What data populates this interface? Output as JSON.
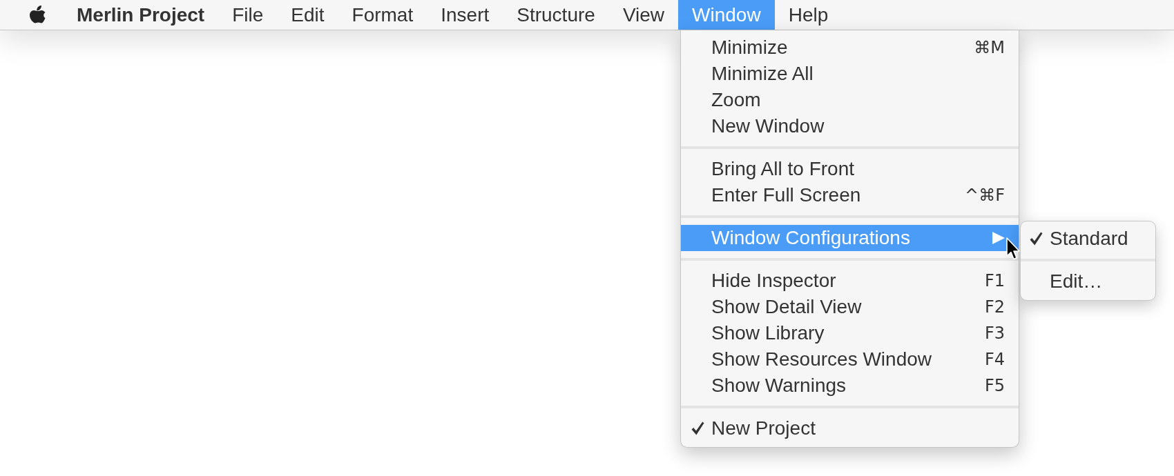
{
  "menu_bar": {
    "items": [
      {
        "label": "Merlin Project",
        "kind": "app",
        "selected": false
      },
      {
        "label": "File",
        "kind": "menu",
        "selected": false
      },
      {
        "label": "Edit",
        "kind": "menu",
        "selected": false
      },
      {
        "label": "Format",
        "kind": "menu",
        "selected": false
      },
      {
        "label": "Insert",
        "kind": "menu",
        "selected": false
      },
      {
        "label": "Structure",
        "kind": "menu",
        "selected": false
      },
      {
        "label": "View",
        "kind": "menu",
        "selected": false
      },
      {
        "label": "Window",
        "kind": "menu",
        "selected": true
      },
      {
        "label": "Help",
        "kind": "menu",
        "selected": false
      }
    ]
  },
  "menu": {
    "sections": [
      {
        "items": [
          {
            "label": "Minimize",
            "shortcut": "⌘M",
            "selected": false,
            "checked": false,
            "submenu": false
          },
          {
            "label": "Minimize All",
            "selected": false,
            "checked": false,
            "submenu": false
          },
          {
            "label": "Zoom",
            "selected": false,
            "checked": false,
            "submenu": false
          },
          {
            "label": "New Window",
            "selected": false,
            "checked": false,
            "submenu": false
          }
        ]
      },
      {
        "items": [
          {
            "label": "Bring All to Front",
            "selected": false,
            "checked": false,
            "submenu": false
          },
          {
            "label": "Enter Full Screen",
            "shortcut": "^⌘F",
            "selected": false,
            "checked": false,
            "submenu": false
          }
        ]
      },
      {
        "items": [
          {
            "label": "Window Configurations",
            "selected": true,
            "checked": false,
            "submenu": true
          }
        ]
      },
      {
        "items": [
          {
            "label": "Hide Inspector",
            "shortcut": "F1",
            "selected": false,
            "checked": false,
            "submenu": false
          },
          {
            "label": "Show Detail View",
            "shortcut": "F2",
            "selected": false,
            "checked": false,
            "submenu": false
          },
          {
            "label": "Show Library",
            "shortcut": "F3",
            "selected": false,
            "checked": false,
            "submenu": false
          },
          {
            "label": "Show Resources Window",
            "shortcut": "F4",
            "selected": false,
            "checked": false,
            "submenu": false
          },
          {
            "label": "Show Warnings",
            "shortcut": "F5",
            "selected": false,
            "checked": false,
            "submenu": false
          }
        ]
      },
      {
        "items": [
          {
            "label": "New Project",
            "selected": false,
            "checked": true,
            "submenu": false
          }
        ]
      }
    ]
  },
  "submenu": {
    "sections": [
      {
        "items": [
          {
            "label": "Standard",
            "selected": false,
            "checked": true,
            "submenu": false
          }
        ]
      },
      {
        "items": [
          {
            "label": "Edit…",
            "selected": false,
            "checked": false,
            "submenu": false
          }
        ]
      }
    ]
  }
}
